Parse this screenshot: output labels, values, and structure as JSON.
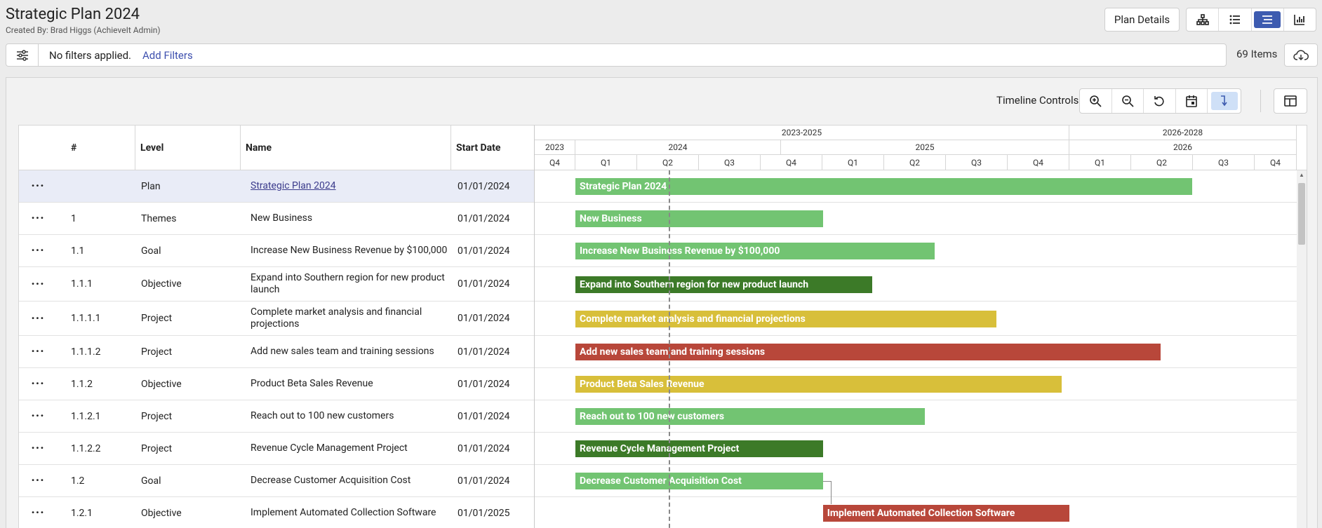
{
  "header": {
    "title": "Strategic Plan 2024",
    "subtitle": "Created By: Brad Higgs (AchieveIt Admin)",
    "plan_details_label": "Plan Details",
    "view_icons": [
      "hierarchy-icon",
      "list-icon",
      "gantt-icon",
      "chart-icon"
    ]
  },
  "filters": {
    "status": "No filters applied.",
    "add_label": "Add Filters",
    "items_count": "69 Items"
  },
  "timeline": {
    "label": "Timeline Controls",
    "controls": [
      "zoom-in-icon",
      "zoom-out-icon",
      "reset-icon",
      "calendar-icon",
      "dependencies-icon"
    ]
  },
  "table": {
    "columns": [
      "#",
      "Level",
      "Name",
      "Start Date"
    ],
    "rows": [
      {
        "num": "",
        "level": "Plan",
        "name": "Strategic Plan 2024",
        "date": "01/01/2024"
      },
      {
        "num": "1",
        "level": "Themes",
        "name": "New Business",
        "date": "01/01/2024"
      },
      {
        "num": "1.1",
        "level": "Goal",
        "name": "Increase New Business Revenue by $100,000",
        "date": "01/01/2024"
      },
      {
        "num": "1.1.1",
        "level": "Objective",
        "name": "Expand into Southern region for new product launch",
        "date": "01/01/2024"
      },
      {
        "num": "1.1.1.1",
        "level": "Project",
        "name": "Complete market analysis and financial projections",
        "date": "01/01/2024"
      },
      {
        "num": "1.1.1.2",
        "level": "Project",
        "name": "Add new sales team and training sessions",
        "date": "01/01/2024"
      },
      {
        "num": "1.1.2",
        "level": "Objective",
        "name": "Product Beta Sales Revenue",
        "date": "01/01/2024"
      },
      {
        "num": "1.1.2.1",
        "level": "Project",
        "name": "Reach out to 100 new customers",
        "date": "01/01/2024"
      },
      {
        "num": "1.1.2.2",
        "level": "Project",
        "name": "Revenue Cycle Management Project",
        "date": "01/01/2024"
      },
      {
        "num": "1.2",
        "level": "Goal",
        "name": "Decrease Customer Acquisition Cost",
        "date": "01/01/2024"
      },
      {
        "num": "1.2.1",
        "level": "Objective",
        "name": "Implement Automated Collection Software",
        "date": "01/01/2025"
      }
    ]
  },
  "gantt": {
    "groups": [
      "2023-2025",
      "2026-2028"
    ],
    "years": [
      "2023",
      "2024",
      "2025",
      "2026"
    ],
    "quarters": [
      "Q4",
      "Q1",
      "Q2",
      "Q3",
      "Q4",
      "Q1",
      "Q2",
      "Q3",
      "Q4",
      "Q1",
      "Q2",
      "Q3",
      "Q4"
    ],
    "bars": [
      {
        "label": "Strategic Plan 2024",
        "start": "2024-01-01",
        "end": "2026-07-01",
        "color": "#72c472"
      },
      {
        "label": "New Business",
        "start": "2024-01-01",
        "end": "2025-01-01",
        "color": "#72c472"
      },
      {
        "label": "Increase New Business Revenue by $100,000",
        "start": "2024-01-01",
        "end": "2025-06-15",
        "color": "#72c472"
      },
      {
        "label": "Expand into Southern region for new product launch",
        "start": "2024-01-01",
        "end": "2025-03-15",
        "color": "#3c7a28"
      },
      {
        "label": "Complete market analysis and financial projections",
        "start": "2024-01-01",
        "end": "2025-09-15",
        "color": "#d8bf3a"
      },
      {
        "label": "Add new sales team and training sessions",
        "start": "2024-01-01",
        "end": "2026-05-15",
        "color": "#b8473a"
      },
      {
        "label": "Product Beta Sales Revenue",
        "start": "2024-01-01",
        "end": "2025-12-20",
        "color": "#d8bf3a"
      },
      {
        "label": "Reach out to 100 new customers",
        "start": "2024-01-01",
        "end": "2025-06-01",
        "color": "#72c472"
      },
      {
        "label": "Revenue Cycle Management Project",
        "start": "2024-01-01",
        "end": "2025-01-01",
        "color": "#3c7a28"
      },
      {
        "label": "Decrease Customer Acquisition Cost",
        "start": "2024-01-01",
        "end": "2025-01-01",
        "color": "#72c472"
      },
      {
        "label": "Implement Automated Collection Software",
        "start": "2025-01-01",
        "end": "2026-01-01",
        "color": "#b8473a"
      }
    ]
  }
}
